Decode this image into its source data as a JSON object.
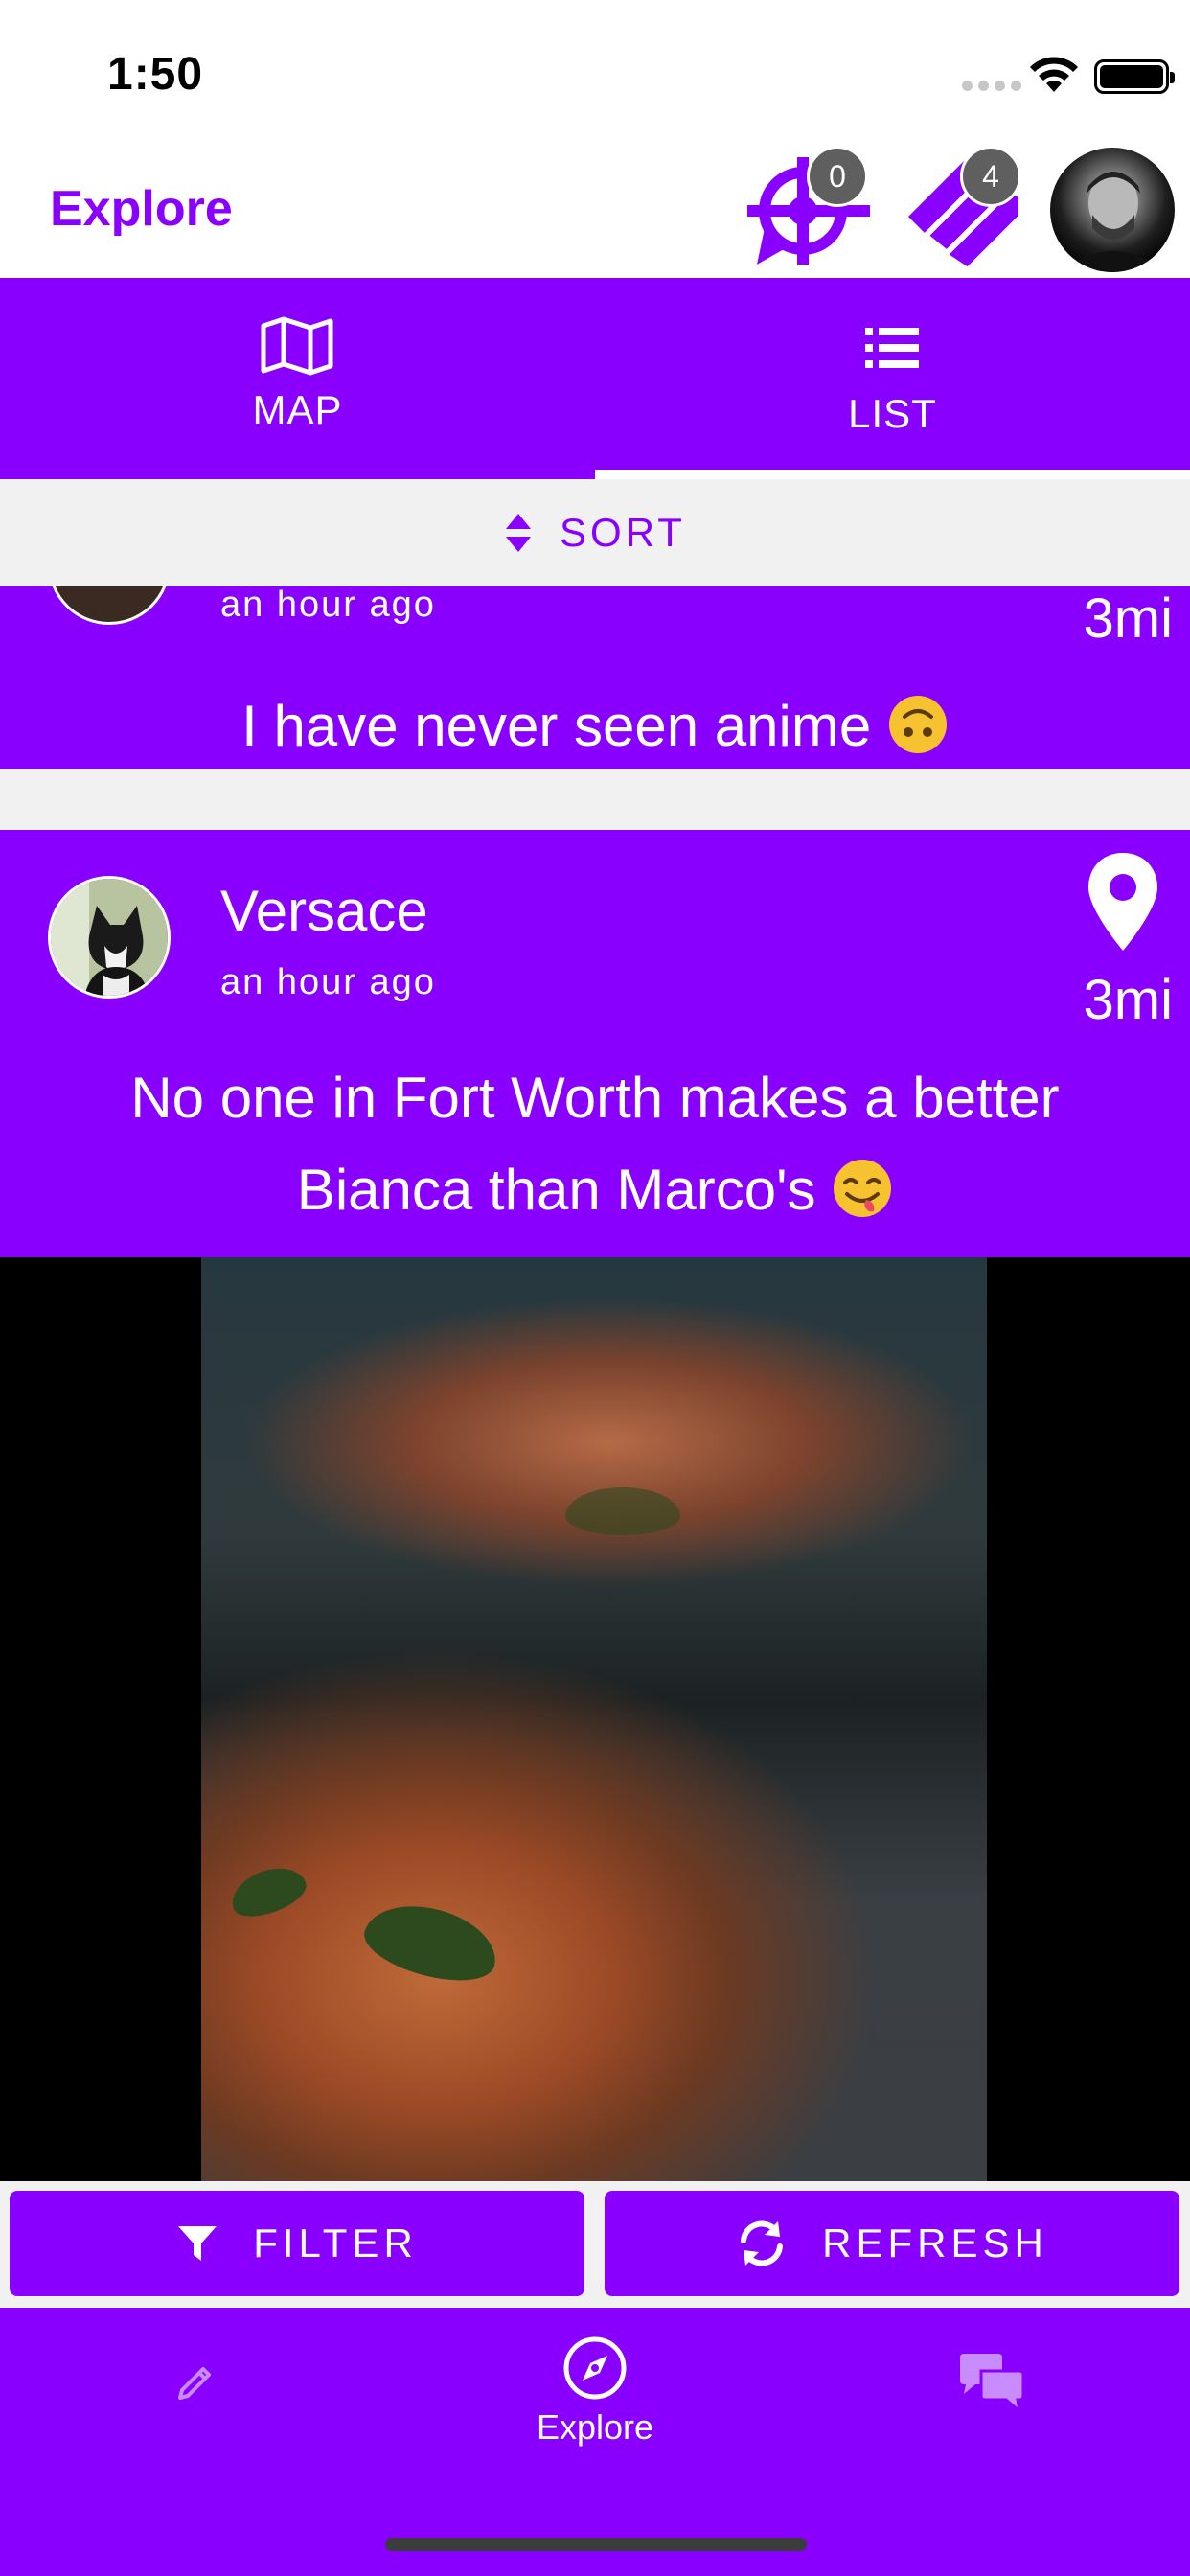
{
  "status_bar": {
    "time": "1:50"
  },
  "header": {
    "title": "Explore",
    "target_badge": "0",
    "tags_badge": "4"
  },
  "tabs": [
    {
      "label": "MAP",
      "icon": "map-icon",
      "selected": false
    },
    {
      "label": "LIST",
      "icon": "list-icon",
      "selected": true
    }
  ],
  "sort": {
    "label": "SORT",
    "icon": "sort-icon"
  },
  "posts": [
    {
      "time": "an hour ago",
      "distance": "3mi",
      "text": "I have never seen anime",
      "emoji": "upside-down-face"
    },
    {
      "user": "Versace",
      "time": "an hour ago",
      "distance": "3mi",
      "text_line1": "No one in Fort Worth makes a better",
      "text_line2": "Bianca than Marco's",
      "emoji": "yum-face",
      "image": "pizza-photo"
    }
  ],
  "actions": {
    "filter_label": "FILTER",
    "refresh_label": "REFRESH"
  },
  "bottom_nav": [
    {
      "icon": "pencil-icon",
      "label": ""
    },
    {
      "icon": "compass-icon",
      "label": "Explore",
      "active": true
    },
    {
      "icon": "chat-bubbles-icon",
      "label": ""
    }
  ],
  "colors": {
    "brand": "#8a00ff",
    "badge": "#5f5f5f",
    "sort_bg": "#f1f1f1"
  }
}
